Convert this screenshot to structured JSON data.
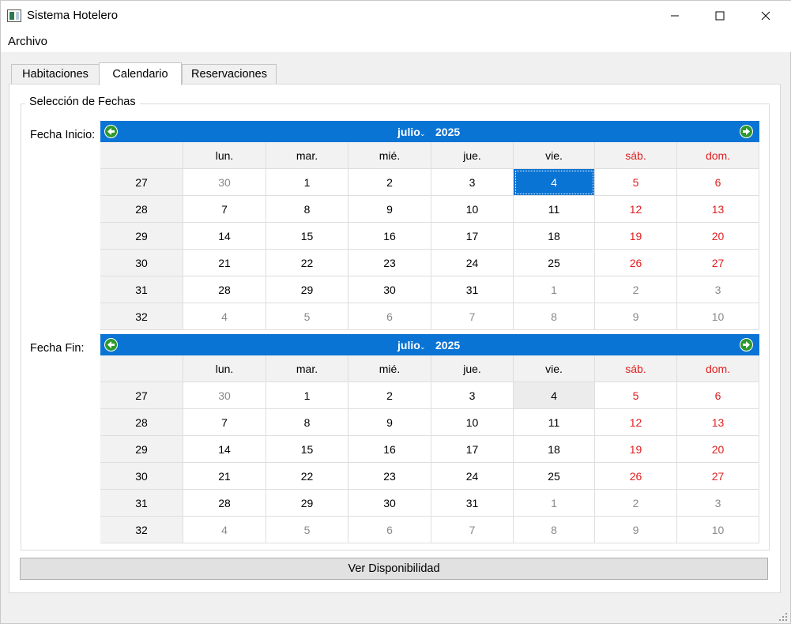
{
  "window": {
    "title": "Sistema Hotelero",
    "controls": {
      "minimize": "–",
      "maximize": "☐",
      "close": "✕"
    }
  },
  "menu": {
    "archivo": "Archivo"
  },
  "tabs": [
    {
      "label": "Habitaciones",
      "active": false
    },
    {
      "label": "Calendario",
      "active": true
    },
    {
      "label": "Reservaciones",
      "active": false
    }
  ],
  "group": {
    "title": "Selección de Fechas"
  },
  "calendars": [
    {
      "label": "Fecha Inicio:",
      "month": "julio",
      "year": "2025",
      "weekdays": [
        "lun.",
        "mar.",
        "mié.",
        "jue.",
        "vie.",
        "sáb.",
        "dom."
      ],
      "weeks": [
        {
          "num": "27",
          "days": [
            "30",
            "1",
            "2",
            "3",
            "4",
            "5",
            "6"
          ]
        },
        {
          "num": "28",
          "days": [
            "7",
            "8",
            "9",
            "10",
            "11",
            "12",
            "13"
          ]
        },
        {
          "num": "29",
          "days": [
            "14",
            "15",
            "16",
            "17",
            "18",
            "19",
            "20"
          ]
        },
        {
          "num": "30",
          "days": [
            "21",
            "22",
            "23",
            "24",
            "25",
            "26",
            "27"
          ]
        },
        {
          "num": "31",
          "days": [
            "28",
            "29",
            "30",
            "31",
            "1",
            "2",
            "3"
          ]
        },
        {
          "num": "32",
          "days": [
            "4",
            "5",
            "6",
            "7",
            "8",
            "9",
            "10"
          ]
        }
      ],
      "selected_day": "4",
      "selected_style": "selected"
    },
    {
      "label": "Fecha Fin:",
      "month": "julio",
      "year": "2025",
      "weekdays": [
        "lun.",
        "mar.",
        "mié.",
        "jue.",
        "vie.",
        "sáb.",
        "dom."
      ],
      "weeks": [
        {
          "num": "27",
          "days": [
            "30",
            "1",
            "2",
            "3",
            "4",
            "5",
            "6"
          ]
        },
        {
          "num": "28",
          "days": [
            "7",
            "8",
            "9",
            "10",
            "11",
            "12",
            "13"
          ]
        },
        {
          "num": "29",
          "days": [
            "14",
            "15",
            "16",
            "17",
            "18",
            "19",
            "20"
          ]
        },
        {
          "num": "30",
          "days": [
            "21",
            "22",
            "23",
            "24",
            "25",
            "26",
            "27"
          ]
        },
        {
          "num": "31",
          "days": [
            "28",
            "29",
            "30",
            "31",
            "1",
            "2",
            "3"
          ]
        },
        {
          "num": "32",
          "days": [
            "4",
            "5",
            "6",
            "7",
            "8",
            "9",
            "10"
          ]
        }
      ],
      "selected_day": "4",
      "selected_style": "today-soft"
    }
  ],
  "actions": {
    "check_availability": "Ver Disponibilidad"
  },
  "colors": {
    "header_blue": "#0a74d4",
    "weekend_red": "#e02020",
    "nav_green": "#2e9a2e"
  }
}
